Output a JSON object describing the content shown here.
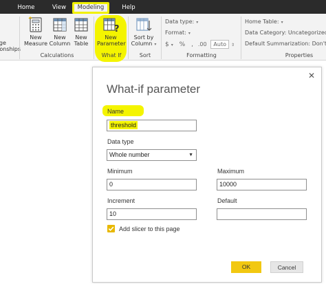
{
  "tabs": {
    "home": "Home",
    "view": "View",
    "modeling": "Modeling",
    "help": "Help"
  },
  "ribbon": {
    "partial_left_top": "age",
    "partial_left_bottom": "tionships",
    "new_measure_1": "New",
    "new_measure_2": "Measure",
    "new_column_1": "New",
    "new_column_2": "Column",
    "new_table_1": "New",
    "new_table_2": "Table",
    "calculations": "Calculations",
    "new_parameter_1": "New",
    "new_parameter_2": "Parameter",
    "what_if": "What If",
    "sort_by_1": "Sort by",
    "sort_by_2": "Column",
    "sort": "Sort",
    "data_type": "Data type:",
    "format": "Format:",
    "currency": "$",
    "percent": "%",
    "comma": ",",
    "decimals": ".00",
    "auto": "Auto",
    "formatting": "Formatting",
    "home_table": "Home Table:",
    "data_category": "Data Category: Uncategorized",
    "default_summarization": "Default Summarization: Don't s",
    "properties": "Properties"
  },
  "dialog": {
    "title": "What-if parameter",
    "close": "✕",
    "name_label": "Name",
    "name_value": "threshold",
    "data_type_label": "Data type",
    "data_type_value": "Whole number",
    "minimum_label": "Minimum",
    "minimum_value": "0",
    "maximum_label": "Maximum",
    "maximum_value": "10000",
    "increment_label": "Increment",
    "increment_value": "10",
    "default_label": "Default",
    "default_value": "",
    "slicer_label": "Add slicer to this page",
    "slicer_checked": true,
    "ok": "OK",
    "cancel": "Cancel"
  },
  "colors": {
    "highlight": "#f4f400",
    "ok_button": "#f2c811",
    "checkbox": "#e8b800",
    "tab_bar": "#2b2b2b"
  }
}
